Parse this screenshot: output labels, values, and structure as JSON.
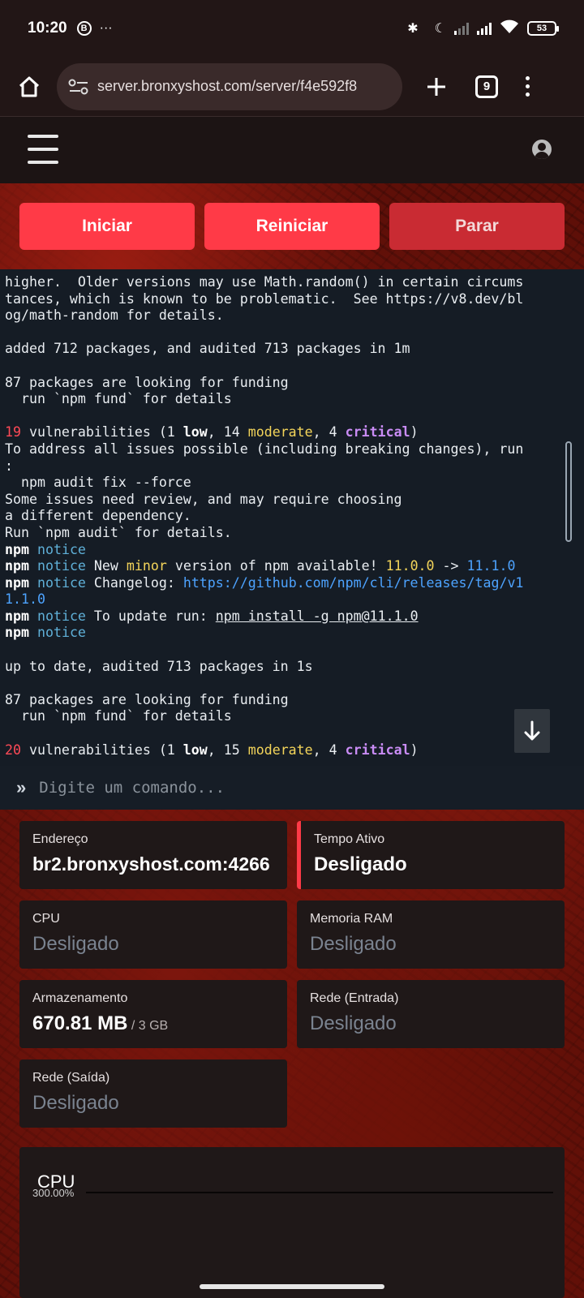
{
  "status_bar": {
    "time": "10:20",
    "notification_badge": "B",
    "more_indicator": "···",
    "battery": "53"
  },
  "browser": {
    "url": "server.bronxyshost.com/server/f4e592f8",
    "tab_count": "9"
  },
  "power": {
    "start": "Iniciar",
    "restart": "Reiniciar",
    "stop": "Parar"
  },
  "console": {
    "lines": [
      [
        {
          "t": "higher.  Older versions may use Math.random() in certain circums"
        }
      ],
      [
        {
          "t": "tances, which is known to be problematic.  See https://v8.dev/bl"
        }
      ],
      [
        {
          "t": "og/math-random for details."
        }
      ],
      [
        {
          "t": ""
        }
      ],
      [
        {
          "t": "added 712 packages, and audited 713 packages in 1m"
        }
      ],
      [
        {
          "t": ""
        }
      ],
      [
        {
          "t": "87 packages are looking for funding"
        }
      ],
      [
        {
          "t": "  run `npm fund` for details"
        }
      ],
      [
        {
          "t": ""
        }
      ],
      [
        {
          "t": "19",
          "c": "c-red"
        },
        {
          "t": " vulnerabilities (1 "
        },
        {
          "t": "low",
          "c": "c-white-b"
        },
        {
          "t": ", 14 "
        },
        {
          "t": "moderate",
          "c": "c-yellow"
        },
        {
          "t": ", 4 "
        },
        {
          "t": "critical",
          "c": "c-purple"
        },
        {
          "t": ")"
        }
      ],
      [
        {
          "t": "To address all issues possible (including breaking changes), run"
        }
      ],
      [
        {
          "t": ":"
        }
      ],
      [
        {
          "t": "  npm audit fix --force"
        }
      ],
      [
        {
          "t": "Some issues need review, and may require choosing"
        }
      ],
      [
        {
          "t": "a different dependency."
        }
      ],
      [
        {
          "t": "Run `npm audit` for details."
        }
      ],
      [
        {
          "t": "npm",
          "c": "c-white-b"
        },
        {
          "t": " "
        },
        {
          "t": "notice",
          "c": "c-teal"
        }
      ],
      [
        {
          "t": "npm",
          "c": "c-white-b"
        },
        {
          "t": " "
        },
        {
          "t": "notice",
          "c": "c-teal"
        },
        {
          "t": " New "
        },
        {
          "t": "minor",
          "c": "c-yellow"
        },
        {
          "t": " version of npm available! "
        },
        {
          "t": "11.0.0",
          "c": "c-yellow"
        },
        {
          "t": " -> "
        },
        {
          "t": "11.1.0",
          "c": "c-blue"
        }
      ],
      [
        {
          "t": "npm",
          "c": "c-white-b"
        },
        {
          "t": " "
        },
        {
          "t": "notice",
          "c": "c-teal"
        },
        {
          "t": " Changelog: "
        },
        {
          "t": "https://github.com/npm/cli/releases/tag/v1",
          "c": "c-blue"
        }
      ],
      [
        {
          "t": "1.1.0",
          "c": "c-blue"
        }
      ],
      [
        {
          "t": "npm",
          "c": "c-white-b"
        },
        {
          "t": " "
        },
        {
          "t": "notice",
          "c": "c-teal"
        },
        {
          "t": " To update run: "
        },
        {
          "t": "npm install -g npm@11.1.0",
          "c": "c-ul"
        }
      ],
      [
        {
          "t": "npm",
          "c": "c-white-b"
        },
        {
          "t": " "
        },
        {
          "t": "notice",
          "c": "c-teal"
        }
      ],
      [
        {
          "t": ""
        }
      ],
      [
        {
          "t": "up to date, audited 713 packages in 1s"
        }
      ],
      [
        {
          "t": ""
        }
      ],
      [
        {
          "t": "87 packages are looking for funding"
        }
      ],
      [
        {
          "t": "  run `npm fund` for details"
        }
      ],
      [
        {
          "t": ""
        }
      ],
      [
        {
          "t": "20",
          "c": "c-red"
        },
        {
          "t": " vulnerabilities (1 "
        },
        {
          "t": "low",
          "c": "c-white-b"
        },
        {
          "t": ", 15 "
        },
        {
          "t": "moderate",
          "c": "c-yellow"
        },
        {
          "t": ", 4 "
        },
        {
          "t": "critical",
          "c": "c-purple"
        },
        {
          "t": ")"
        }
      ]
    ]
  },
  "command_input": {
    "prompt": "»",
    "placeholder": "Digite um comando..."
  },
  "stats": {
    "address": {
      "label": "Endereço",
      "value": "br2.bronxyshost.com:4266"
    },
    "uptime": {
      "label": "Tempo Ativo",
      "value": "Desligado"
    },
    "cpu": {
      "label": "CPU",
      "value": "Desligado"
    },
    "ram": {
      "label": "Memoria RAM",
      "value": "Desligado"
    },
    "storage": {
      "label": "Armazenamento",
      "value": "670.81 MB",
      "sub": " / 3 GB"
    },
    "net_in": {
      "label": "Rede (Entrada)",
      "value": "Desligado"
    },
    "net_out": {
      "label": "Rede (Saída)",
      "value": "Desligado"
    }
  },
  "chart_data": {
    "type": "line",
    "title": "CPU",
    "y_tick_labels": [
      "300.00%"
    ],
    "series": []
  },
  "colors": {
    "accent": "#ff3a47",
    "console_bg": "#151c25",
    "card_bg": "#1f1818"
  }
}
